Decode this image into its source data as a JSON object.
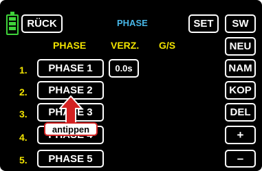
{
  "header": {
    "back_label": "RÜCK",
    "title": "PHASE",
    "set_label": "SET",
    "sw_label": "SW"
  },
  "columns": {
    "phase": "PHASE",
    "delay": "VERZ.",
    "gs": "G/S"
  },
  "rows": [
    {
      "number": "1.",
      "label": "PHASE 1",
      "delay": "0.0s"
    },
    {
      "number": "2.",
      "label": "PHASE 2"
    },
    {
      "number": "3.",
      "label": "PHASE 3"
    },
    {
      "number": "4.",
      "label": "PHASE 4"
    },
    {
      "number": "5.",
      "label": "PHASE 5"
    }
  ],
  "side_buttons": {
    "new": "NEU",
    "name": "NAM",
    "copy": "KOP",
    "delete": "DEL",
    "plus": "+",
    "minus": "–"
  },
  "annotation": {
    "label": "antippen"
  },
  "colors": {
    "background": "#000000",
    "text": "#ffffff",
    "accent_yellow": "#f2e400",
    "title_cyan": "#47b7e8",
    "battery_green": "#3fd33a",
    "annotation_red": "#d32222"
  }
}
